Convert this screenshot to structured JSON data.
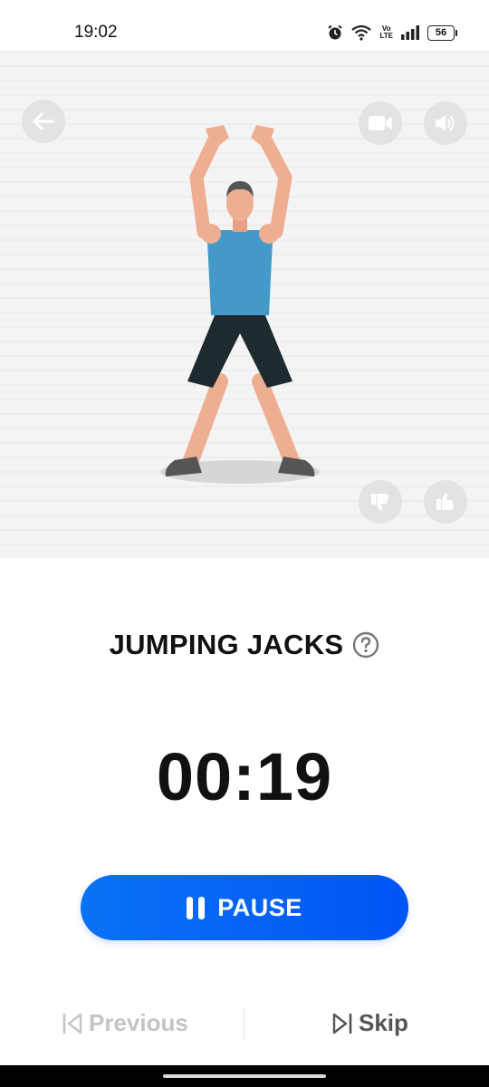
{
  "status_bar": {
    "time": "19:02",
    "battery": "56",
    "network_label": "Vo LTE",
    "icons": [
      "alarm-icon",
      "wifi-icon",
      "volte-icon",
      "signal-icon",
      "battery-icon"
    ]
  },
  "animation": {
    "buttons": [
      "back-arrow-icon",
      "video-icon",
      "sound-icon",
      "thumbs-down-icon",
      "thumbs-up-icon"
    ],
    "background_color": "#f4f4f4",
    "button_color": "#e1e1e1"
  },
  "exercise": {
    "title": "JUMPING JACKS",
    "timer": "00:19"
  },
  "controls": {
    "pause_label": "PAUSE",
    "accent_color": "#0a66f5"
  },
  "navigation": {
    "previous_label": "Previous",
    "skip_label": "Skip"
  }
}
